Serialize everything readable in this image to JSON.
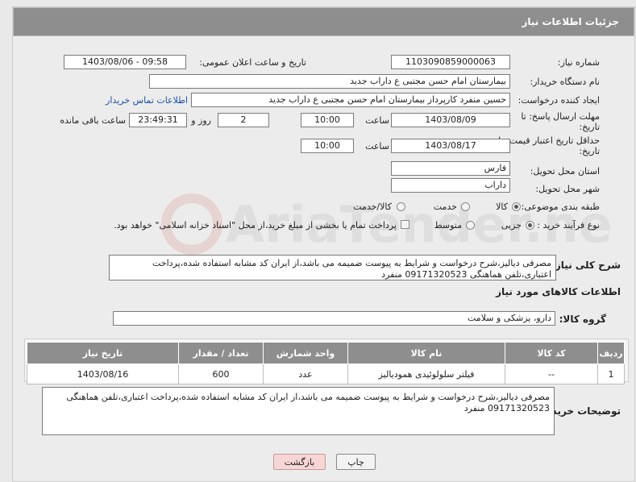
{
  "header": {
    "title": "جزئیات اطلاعات نیاز"
  },
  "fields": {
    "need_number_label": "شماره نیاز:",
    "need_number": "1103090859000063",
    "announce_label": "تاریخ و ساعت اعلان عمومی:",
    "announce_value": "1403/08/06 - 09:58",
    "buyer_org_label": "نام دستگاه خریدار:",
    "buyer_org": "بیمارستان امام حسن مجتبی  ع  داراب جدید",
    "requester_label": "ایجاد کننده درخواست:",
    "requester": "حسین  منفرد کارپرداز بیمارستان امام حسن مجتبی  ع  داراب جدید",
    "contact_link": "اطلاعات تماس خریدار",
    "reply_deadline_label_1": "مهلت ارسال پاسخ: تا",
    "reply_deadline_label_2": "تاریخ:",
    "reply_date": "1403/08/09",
    "time_label": "ساعت",
    "reply_time": "10:00",
    "days_value": "2",
    "days_label": "روز و",
    "remaining_time": "23:49:31",
    "remaining_label": "ساعت باقی مانده",
    "validity_label_1": "حداقل تاریخ اعتبار قیمت: تا",
    "validity_label_2": "تاریخ:",
    "validity_date": "1403/08/17",
    "validity_time": "10:00",
    "province_label": "استان محل تحویل:",
    "province": "فارس",
    "city_label": "شهر محل تحویل:",
    "city": "داراب",
    "category_label": "طبقه بندی موضوعی:",
    "cat_goods": "کالا",
    "cat_service": "خدمت",
    "cat_goods_service": "کالا/خدمت",
    "process_label": "نوع فرآیند خرید :",
    "proc_partial": "جزیی",
    "proc_medium": "متوسط",
    "payment_note": "پرداخت تمام یا بخشی از مبلغ خرید،از محل \"اسناد خزانه اسلامی\" خواهد بود.",
    "summary_label": "شرح کلی نیاز:",
    "summary": "مصرفی دیالیز،شرح درخواست و شرایط به پیوست ضمیمه می باشد،از ایران کد مشابه استفاده شده،پرداخت اعتباری،تلفن هماهنگی 09171320523 منفرد",
    "goods_info_title": "اطلاعات کالاهای مورد نیاز",
    "goods_group_label": "گروه کالا:",
    "goods_group": "دارو، پزشکی و سلامت"
  },
  "table": {
    "headers": [
      "ردیف",
      "کد کالا",
      "نام کالا",
      "واحد شمارش",
      "تعداد / مقدار",
      "تاریخ نیاز"
    ],
    "rows": [
      {
        "row": "1",
        "code": "--",
        "name": "فیلتر سلولوئیدی همودیالیز",
        "unit": "عدد",
        "qty": "600",
        "date": "1403/08/16"
      }
    ]
  },
  "buyer_notes_label": "توضیحات خریدار:",
  "buyer_notes": "مصرفی دیالیز،شرح درخواست و شرایط به پیوست ضمیمه می باشد،از ایران کد مشابه استفاده شده،پرداخت اعتباری،تلفن هماهنگی 09171320523 منفرد",
  "buttons": {
    "print": "چاپ",
    "back": "بازگشت"
  }
}
